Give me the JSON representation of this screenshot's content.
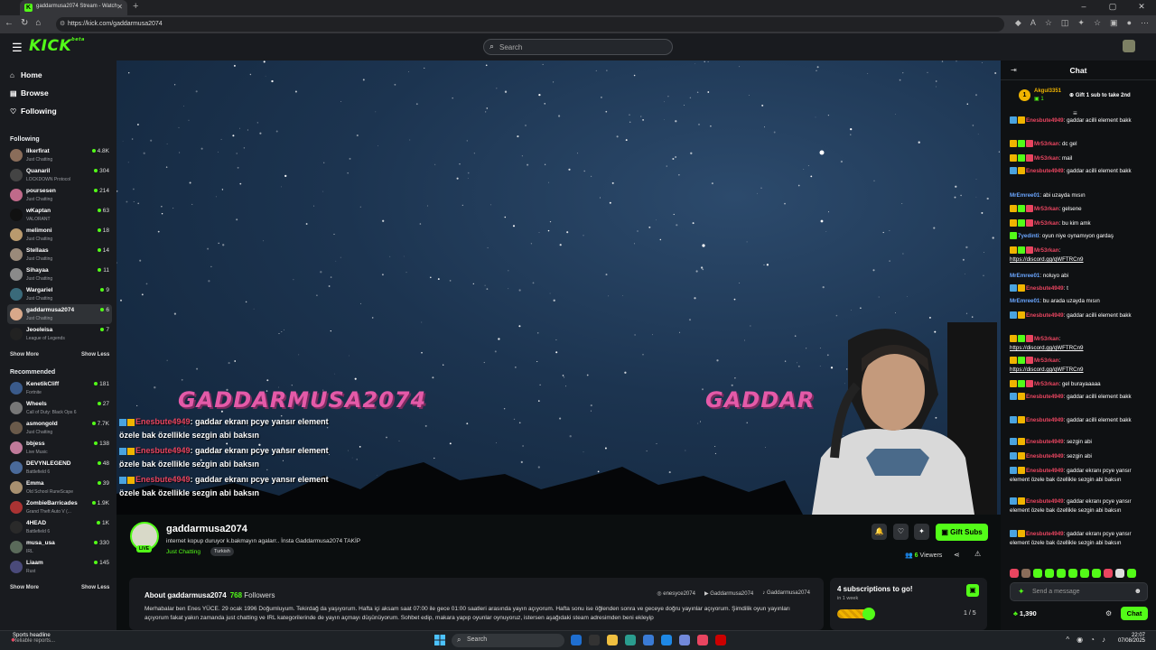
{
  "browser": {
    "tab_title": "gaddarmusa2074 Stream - Watch",
    "url": "https://kick.com/gaddarmusa2074"
  },
  "header": {
    "logo": "KICK",
    "logo_sup": "beta",
    "search_placeholder": "Search"
  },
  "sidebar": {
    "nav": [
      {
        "label": "Home",
        "icon": "home-icon"
      },
      {
        "label": "Browse",
        "icon": "browse-icon"
      },
      {
        "label": "Following",
        "icon": "heart-icon"
      }
    ],
    "following_title": "Following",
    "following": [
      {
        "name": "ilkerfirat",
        "category": "Just Chatting",
        "viewers": "4.8K",
        "color": "#8a6d5a"
      },
      {
        "name": "Quanaril",
        "category": "LOCKDOWN Protocol",
        "viewers": "304",
        "color": "#444"
      },
      {
        "name": "poursesen",
        "category": "Just Chatting",
        "viewers": "214",
        "color": "#c06a8a"
      },
      {
        "name": "wKaptan",
        "category": "VALORANT",
        "viewers": "63",
        "color": "#111"
      },
      {
        "name": "melimoni",
        "category": "Just Chatting",
        "viewers": "18",
        "color": "#b99a6e"
      },
      {
        "name": "Stellaas",
        "category": "Just Chatting",
        "viewers": "14",
        "color": "#9a8a7a"
      },
      {
        "name": "Sihayaa",
        "category": "Just Chatting",
        "viewers": "11",
        "color": "#8a8a8a"
      },
      {
        "name": "Wargariel",
        "category": "Just Chatting",
        "viewers": "9",
        "color": "#3a6a7a"
      },
      {
        "name": "gaddarmusa2074",
        "category": "Just Chatting",
        "viewers": "6",
        "color": "#d8a88a"
      },
      {
        "name": "Jeoeleisa",
        "category": "League of Legends",
        "viewers": "7",
        "color": "#222"
      }
    ],
    "show_more": "Show More",
    "show_less": "Show Less",
    "recommended_title": "Recommended",
    "recommended": [
      {
        "name": "KenetikCliff",
        "category": "Fortnite",
        "viewers": "181",
        "color": "#3a5a8a"
      },
      {
        "name": "Wheels",
        "category": "Call of Duty: Black Ops 6",
        "viewers": "27",
        "color": "#777"
      },
      {
        "name": "asmongold",
        "category": "Just Chatting",
        "viewers": "7.7K",
        "color": "#6a5a4a"
      },
      {
        "name": "bbjess",
        "category": "Live Music",
        "viewers": "138",
        "color": "#c07a9a"
      },
      {
        "name": "DEVYNLEGEND",
        "category": "Battlefield 6",
        "viewers": "48",
        "color": "#4a6a9a"
      },
      {
        "name": "Emma",
        "category": "Old School RuneScape",
        "viewers": "39",
        "color": "#a89070"
      },
      {
        "name": "ZombieBarricades",
        "category": "Grand Theft Auto V (...",
        "viewers": "1.9K",
        "color": "#aa3333"
      },
      {
        "name": "4HEAD",
        "category": "Battlefield 6",
        "viewers": "1K",
        "color": "#2a2a2a"
      },
      {
        "name": "musa_usa",
        "category": "IRL",
        "viewers": "330",
        "color": "#5a6a5a"
      },
      {
        "name": "Liaam",
        "category": "Rust",
        "viewers": "145",
        "color": "#4a4a7a"
      }
    ]
  },
  "video": {
    "overlay_name_1": "GADDARMUSA2074",
    "overlay_name_2": "GADDAR",
    "overlay_chat": [
      {
        "user": "Enesbute4949",
        "text": ": gaddar ekranı pcye yansır element özele bak özellikle sezgin abi baksın"
      },
      {
        "user": "Enesbute4949",
        "text": ": gaddar ekranı pcye yansır element özele bak özellikle sezgin abi baksın"
      },
      {
        "user": "Enesbute4949",
        "text": ": gaddar ekranı pcye yansır element özele bak özellikle sezgin abi baksın"
      }
    ]
  },
  "stream": {
    "channel": "gaddarmusa2074",
    "live_label": "LIVE",
    "title": "internet kopup duruyor k.bakmayın agalarr.. İnsta Gaddarmusa2074 TAKİP",
    "category": "Just Chatting",
    "tag": "Turkish",
    "gift_subs": "Gift Subs",
    "viewers_count": "6",
    "viewers_label": "Viewers"
  },
  "about": {
    "title": "About gaddarmusa2074",
    "followers_count": "768",
    "followers_label": "Followers",
    "links": [
      "enesyce2074",
      "Gaddarmusa2074",
      "Gaddarmusa2074"
    ],
    "text": "Merhabalar ben Enes YÜCE. 29 ocak 1996 Doğumluyum. Tekirdağ da yaşıyorum. Hafta içi aksam saat 07:00 ile gece 01:00 saatleri arasında yayın açıyorum. Hafta sonu ise öğlenden sonra ve geceye doğru yayınlar açıyorum. Şimdilik oyun yayınları açıyorum fakat yakın zamanda just chatting ve IRL kategorilerinde de yayın açmayı düşünüyorum. Sohbet edip, makara yapıp oyunlar oynuyoruz, istersen aşağıdaki steam adresimden beni ekleyip"
  },
  "subgoal": {
    "title": "4 subscriptions to go!",
    "subtitle": "in 1 week",
    "count": "1 / 5",
    "progress": 0.2
  },
  "chat": {
    "title": "Chat",
    "pinned_user": "Akgul3351",
    "pinned_count": "1",
    "pinned_text": "Gift 1 sub to take 2nd",
    "messages": [
      {
        "badges": [
          "bdb",
          "bdy"
        ],
        "user": "Enesbute4949",
        "ucolor": "#e94560",
        "text": ": gaddar acilli element bakk"
      },
      {
        "badges": [
          "bdy",
          "bdg",
          "bdp"
        ],
        "user": "Mr53rkan",
        "ucolor": "#e94560",
        "text": ": dc gel"
      },
      {
        "badges": [
          "bdy",
          "bdg",
          "bdp"
        ],
        "user": "Mr53rkan",
        "ucolor": "#e94560",
        "text": ": mail"
      },
      {
        "badges": [
          "bdb",
          "bdy"
        ],
        "user": "Enesbute4949",
        "ucolor": "#e94560",
        "text": ": gaddar acilli element bakk"
      },
      {
        "badges": [],
        "user": "MrEmree01",
        "ucolor": "#6aa6ff",
        "text": ": abi uzayda mısın"
      },
      {
        "badges": [
          "bdy",
          "bdg",
          "bdp"
        ],
        "user": "Mr53rkan",
        "ucolor": "#e94560",
        "text": ": gelsene"
      },
      {
        "badges": [
          "bdy",
          "bdg",
          "bdp"
        ],
        "user": "Mr53rkan",
        "ucolor": "#e94560",
        "text": ": bu kim amk"
      },
      {
        "badges": [
          "bdg"
        ],
        "user": "7yedinti",
        "ucolor": "#6aa6ff",
        "text": ": oyun niye oynamıyon gardaş"
      },
      {
        "badges": [
          "bdy",
          "bdg",
          "bdp"
        ],
        "user": "Mr53rkan",
        "ucolor": "#e94560",
        "text": ":",
        "link": "https://discord.gg/qWFTRCn9"
      },
      {
        "badges": [],
        "user": "MrEmree01",
        "ucolor": "#6aa6ff",
        "text": ": noluyo abi"
      },
      {
        "badges": [
          "bdb",
          "bdy"
        ],
        "user": "Enesbute4949",
        "ucolor": "#e94560",
        "text": ": t"
      },
      {
        "badges": [],
        "user": "MrEmree01",
        "ucolor": "#6aa6ff",
        "text": ": bu arada uzayda mısın"
      },
      {
        "badges": [
          "bdb",
          "bdy"
        ],
        "user": "Enesbute4949",
        "ucolor": "#e94560",
        "text": ": gaddar acilli element bakk"
      },
      {
        "badges": [
          "bdy",
          "bdg",
          "bdp"
        ],
        "user": "Mr53rkan",
        "ucolor": "#e94560",
        "text": ":",
        "link": "https://discord.gg/qWFTRCn9"
      },
      {
        "badges": [
          "bdy",
          "bdg",
          "bdp"
        ],
        "user": "Mr53rkan",
        "ucolor": "#e94560",
        "text": ":",
        "link": "https://discord.gg/qWFTRCn9"
      },
      {
        "badges": [
          "bdy",
          "bdg",
          "bdp"
        ],
        "user": "Mr53rkan",
        "ucolor": "#e94560",
        "text": ": gel burayaaaaa"
      },
      {
        "badges": [
          "bdb",
          "bdy"
        ],
        "user": "Enesbute4949",
        "ucolor": "#e94560",
        "text": ": gaddar acilli element bakk"
      },
      {
        "badges": [
          "bdb",
          "bdy"
        ],
        "user": "Enesbute4949",
        "ucolor": "#e94560",
        "text": ": gaddar acilli element bakk"
      },
      {
        "badges": [
          "bdb",
          "bdy"
        ],
        "user": "Enesbute4949",
        "ucolor": "#e94560",
        "text": ": sezgin abi"
      },
      {
        "badges": [
          "bdb",
          "bdy"
        ],
        "user": "Enesbute4949",
        "ucolor": "#e94560",
        "text": ": sezgin abi"
      },
      {
        "badges": [
          "bdb",
          "bdy"
        ],
        "user": "Enesbute4949",
        "ucolor": "#e94560",
        "text": ": gaddar ekranı pcye yansır element özele bak özellikle sezgin abi baksın"
      },
      {
        "badges": [
          "bdb",
          "bdy"
        ],
        "user": "Enesbute4949",
        "ucolor": "#e94560",
        "text": ": gaddar ekranı pcye yansır element özele bak özellikle sezgin abi baksın"
      },
      {
        "badges": [
          "bdb",
          "bdy"
        ],
        "user": "Enesbute4949",
        "ucolor": "#e94560",
        "text": ": gaddar ekranı pcye yansır element özele bak özellikle sezgin abi baksın"
      }
    ],
    "input_placeholder": "Send a message",
    "points": "1,390",
    "chat_button": "Chat"
  },
  "taskbar": {
    "weather_title": "Sports headline",
    "weather_sub": "Reliable reports...",
    "search": "Search",
    "time": "22:07",
    "date": "07/08/2025"
  }
}
